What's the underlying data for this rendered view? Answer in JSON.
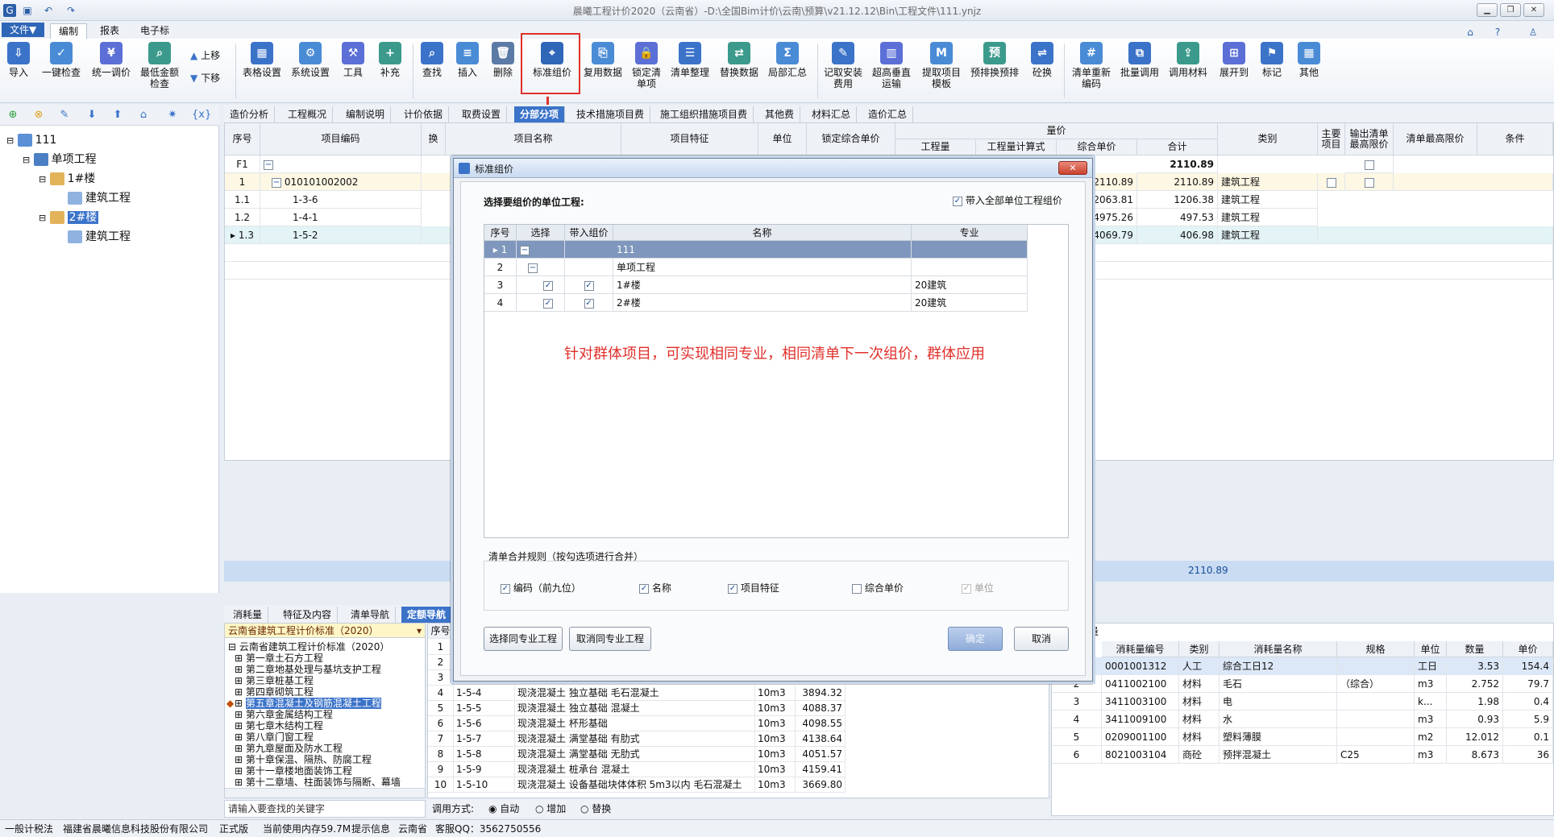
{
  "window": {
    "title": "晨曦工程计价2020（云南省）-D:\\全国Bim计价\\云南\\预算\\v21.12.12\\Bin\\工程文件\\111.ynjz"
  },
  "menu": {
    "file": "文件▼",
    "tabs": [
      "编制",
      "报表",
      "电子标"
    ]
  },
  "ribbon": {
    "buttons": [
      "导入",
      "一键检查",
      "统一调价",
      "最低金额检查",
      "表格设置",
      "系统设置",
      "工具",
      "补充",
      "查找",
      "插入",
      "删除",
      "标准组价",
      "复用数据",
      "锁定清单项",
      "清单整理",
      "替换数据",
      "局部汇总",
      "记取安装费用",
      "超高垂直运输",
      "提取项目模板",
      "预排换预排",
      "砼换",
      "清单重新编码",
      "批量调用",
      "调用材料",
      "展开到",
      "标记",
      "其他"
    ],
    "move_up": "上移",
    "move_down": "下移"
  },
  "tree": {
    "root": "111",
    "single": "单项工程",
    "b1": "1#楼",
    "b1_child": "建筑工程",
    "b2": "2#楼",
    "b2_child": "建筑工程"
  },
  "main_tabs": [
    "造价分析",
    "工程概况",
    "编制说明",
    "计价依据",
    "取费设置",
    "分部分项",
    "技术措施项目费",
    "施工组织措施项目费",
    "其他费",
    "材料汇总",
    "造价汇总"
  ],
  "grid": {
    "headers": {
      "seq": "序号",
      "code": "项目编码",
      "swap": "换",
      "name": "项目名称",
      "feature": "项目特征",
      "unit": "单位",
      "locked": "锁定综合单价",
      "qty": "工程量",
      "qtyexpr": "工程量计算式",
      "uprice": "综合单价",
      "total": "合计",
      "group": "量价",
      "cat": "类别",
      "main": "主要项目",
      "output": "输出清单最高限价",
      "maxprice": "清单最高限价",
      "cond": "条件"
    },
    "rows": [
      {
        "seq": "F1",
        "code": "",
        "uprice": "",
        "total": "2110.89",
        "cat": ""
      },
      {
        "seq": "1",
        "code": "010101002002",
        "uprice": "2110.89",
        "total": "2110.89",
        "cat": "建筑工程"
      },
      {
        "seq": "1.1",
        "code": "1-3-6",
        "uprice": "12063.81",
        "total": "1206.38",
        "cat": "建筑工程"
      },
      {
        "seq": "1.2",
        "code": "1-4-1",
        "uprice": "4975.26",
        "total": "497.53",
        "cat": "建筑工程"
      },
      {
        "seq": "1.3",
        "code": "1-5-2",
        "uprice": "4069.79",
        "total": "406.98",
        "cat": "建筑工程"
      }
    ],
    "sum_total": "2110.89"
  },
  "bottom_tabs": [
    "消耗量",
    "特征及内容",
    "清单导航",
    "定额导航"
  ],
  "library": {
    "select": "云南省建筑工程计价标准（2020）",
    "root": "云南省建筑工程计价标准（2020）",
    "chapters": [
      "第一章土石方工程",
      "第二章地基处理与基坑支护工程",
      "第三章桩基工程",
      "第四章砌筑工程",
      "第五章混凝土及钢筋混凝土工程",
      "第六章金属结构工程",
      "第七章木结构工程",
      "第八章门窗工程",
      "第九章屋面及防水工程",
      "第十章保温、隔热、防腐工程",
      "第十一章楼地面装饰工程",
      "第十二章墙、柱面装饰与隔断、幕墙"
    ],
    "search_placeholder": "请输入要查找的关键字"
  },
  "quota": {
    "seq_header": "序号",
    "rows": [
      {
        "seq": "1",
        "code": "",
        "name": "",
        "unit": "",
        "price": ""
      },
      {
        "seq": "2",
        "code": "",
        "name": "",
        "unit": "",
        "price": ""
      },
      {
        "seq": "3",
        "code": "",
        "name": "",
        "unit": "",
        "price": ""
      },
      {
        "seq": "4",
        "code": "1-5-4",
        "name": "现浇混凝土 独立基础 毛石混凝土",
        "unit": "10m3",
        "price": "3894.32"
      },
      {
        "seq": "5",
        "code": "1-5-5",
        "name": "现浇混凝土 独立基础 混凝土",
        "unit": "10m3",
        "price": "4088.37"
      },
      {
        "seq": "6",
        "code": "1-5-6",
        "name": "现浇混凝土 杯形基础",
        "unit": "10m3",
        "price": "4098.55"
      },
      {
        "seq": "7",
        "code": "1-5-7",
        "name": "现浇混凝土 满堂基础 有肋式",
        "unit": "10m3",
        "price": "4138.64"
      },
      {
        "seq": "8",
        "code": "1-5-8",
        "name": "现浇混凝土 满堂基础 无肋式",
        "unit": "10m3",
        "price": "4051.57"
      },
      {
        "seq": "9",
        "code": "1-5-9",
        "name": "现浇混凝土 桩承台 混凝土",
        "unit": "10m3",
        "price": "4159.41"
      },
      {
        "seq": "10",
        "code": "1-5-10",
        "name": "现浇混凝土 设备基础块体体积 5m3以内 毛石混凝土",
        "unit": "10m3",
        "price": "3669.80"
      }
    ],
    "mode_label": "调用方式:",
    "modes": [
      "自动",
      "增加",
      "替换"
    ]
  },
  "resource": {
    "title": "量",
    "headers": [
      "消耗量编号",
      "类别",
      "消耗量名称",
      "规格",
      "单位",
      "数量",
      "单价"
    ],
    "rows": [
      {
        "seq": "",
        "code": "0001001312",
        "cat": "人工",
        "name": "综合工日12",
        "spec": "",
        "unit": "工日",
        "qty": "3.53",
        "price": "154.4"
      },
      {
        "seq": "2",
        "code": "0411002100",
        "cat": "材料",
        "name": "毛石",
        "spec": "（综合）",
        "unit": "m3",
        "qty": "2.752",
        "price": "79.7"
      },
      {
        "seq": "3",
        "code": "3411003100",
        "cat": "材料",
        "name": "电",
        "spec": "",
        "unit": "k...",
        "qty": "1.98",
        "price": "0.4"
      },
      {
        "seq": "4",
        "code": "3411009100",
        "cat": "材料",
        "name": "水",
        "spec": "",
        "unit": "m3",
        "qty": "0.93",
        "price": "5.9"
      },
      {
        "seq": "5",
        "code": "0209001100",
        "cat": "材料",
        "name": "塑料薄膜",
        "spec": "",
        "unit": "m2",
        "qty": "12.012",
        "price": "0.1"
      },
      {
        "seq": "6",
        "code": "8021003104",
        "cat": "商砼",
        "name": "预拌混凝土",
        "spec": "C25",
        "unit": "m3",
        "qty": "8.673",
        "price": "36"
      }
    ]
  },
  "dialog": {
    "title": "标准组价",
    "prompt": "选择要组价的单位工程:",
    "bring_all": "带入全部单位工程组价",
    "headers": {
      "seq": "序号",
      "select": "选择",
      "bring": "带入组价",
      "name": "名称",
      "major": "专业"
    },
    "rows": [
      {
        "seq": "1",
        "name": "111",
        "major": ""
      },
      {
        "seq": "2",
        "name": "单项工程",
        "major": ""
      },
      {
        "seq": "3",
        "name": "1#楼",
        "major": "20建筑"
      },
      {
        "seq": "4",
        "name": "2#楼",
        "major": "20建筑"
      }
    ],
    "annotation": "针对群体项目，可实现相同专业，相同清单下一次组价，群体应用",
    "merge_title": "清单合并规则（按勾选项进行合并）",
    "merge_options": [
      "编码（前九位）",
      "名称",
      "项目特征",
      "综合单价",
      "单位"
    ],
    "btn_select_same": "选择同专业工程",
    "btn_cancel_same": "取消同专业工程",
    "btn_ok": "确定",
    "btn_cancel": "取消"
  },
  "status": {
    "mode": "一般计税法",
    "company": "福建省晨曦信息科技股份有限公司",
    "edition": "正式版",
    "memory": "当前使用内存59.7M",
    "hint": "提示信息",
    "province": "云南省",
    "qq": "客服QQ：3562750556"
  },
  "colors": {
    "accent": "#3b73c9",
    "highlight": "#e0302b",
    "annotation": "#e0302b"
  }
}
